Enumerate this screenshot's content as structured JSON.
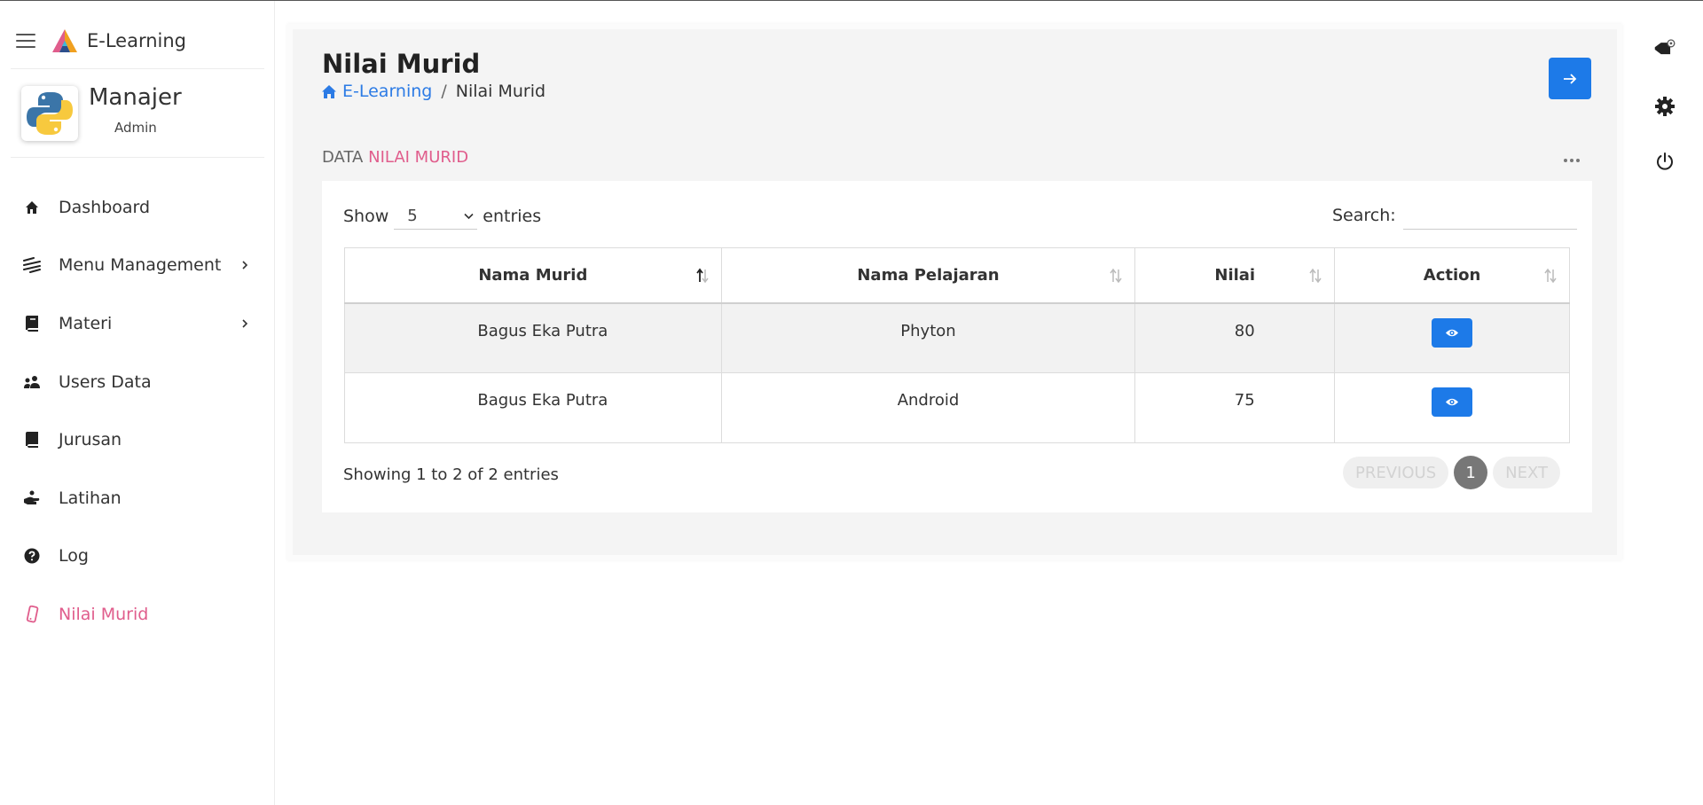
{
  "brand": {
    "name": "E-Learning"
  },
  "profile": {
    "name": "Manajer",
    "role": "Admin"
  },
  "sidebar": {
    "items": [
      {
        "label": "Dashboard",
        "icon": "home-icon"
      },
      {
        "label": "Menu Management",
        "icon": "layers-icon",
        "has_submenu": true
      },
      {
        "label": "Materi",
        "icon": "book-icon",
        "has_submenu": true
      },
      {
        "label": "Users Data",
        "icon": "users-icon"
      },
      {
        "label": "Jurusan",
        "icon": "book-icon"
      },
      {
        "label": "Latihan",
        "icon": "hand-icon"
      },
      {
        "label": "Log",
        "icon": "question-circle-icon"
      },
      {
        "label": "Nilai Murid",
        "icon": "phone-icon",
        "active": true
      }
    ]
  },
  "page": {
    "title": "Nilai Murid",
    "breadcrumb": {
      "home": "E-Learning",
      "separator": "/",
      "current": "Nilai Murid"
    }
  },
  "section": {
    "title_prefix": "DATA",
    "title_accent": "NILAI MURID"
  },
  "table_controls": {
    "show_label": "Show",
    "entries_value": "5",
    "entries_label": "entries",
    "search_label": "Search:",
    "search_value": ""
  },
  "table": {
    "columns": [
      "Nama Murid",
      "Nama Pelajaran",
      "Nilai",
      "Action"
    ],
    "rows": [
      {
        "nama_murid": "Bagus Eka Putra",
        "nama_pelajaran": "Phyton",
        "nilai": "80",
        "action": "eye-icon"
      },
      {
        "nama_murid": "Bagus Eka Putra",
        "nama_pelajaran": "Android",
        "nilai": "75",
        "action": "eye-icon"
      }
    ]
  },
  "footer": {
    "info": "Showing 1 to 2 of 2 entries",
    "previous": "PREVIOUS",
    "page": "1",
    "next": "NEXT"
  },
  "colors": {
    "primary": "#1d7ae8",
    "accent": "#e05d8c",
    "link": "#2c7be5",
    "card_bg": "#f4f4f4"
  },
  "rail": {
    "icons": [
      "tag-icon",
      "gear-icon",
      "power-icon"
    ]
  }
}
